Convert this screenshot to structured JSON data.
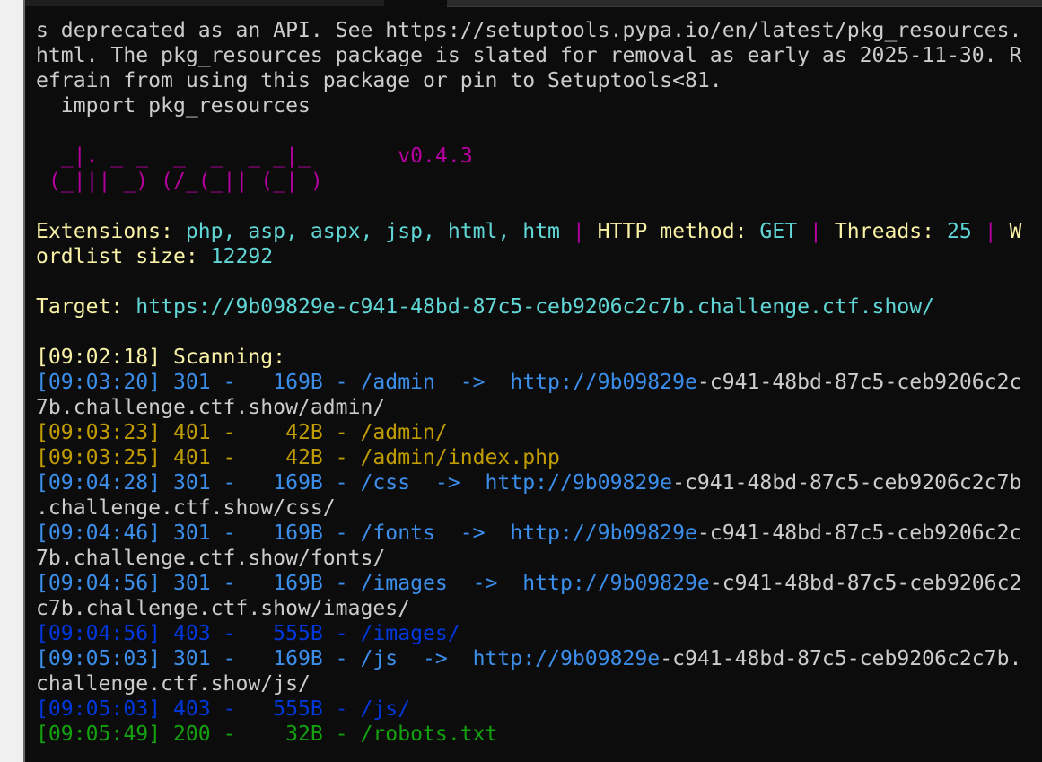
{
  "warning": {
    "line1": "s deprecated as an API. See https://setuptools.pypa.io/en/latest/pkg_resources.",
    "line2": "html. The pkg_resources package is slated for removal as early as 2025-11-30. R",
    "line3": "efrain from using this package or pin to Setuptools<81.",
    "line4": "  import pkg_resources"
  },
  "banner": {
    "line1": "  _|. _ _  _  _  _ _|_",
    "line2": " (_||| _) (/_(_|| (_| )",
    "version": "v0.4.3"
  },
  "config": {
    "extensions_label": "Extensions: ",
    "extensions_value": "php, asp, aspx, jsp, html, htm",
    "separator": " | ",
    "method_label": "HTTP method: ",
    "method_value": "GET",
    "threads_label": "Threads: ",
    "threads_value": "25",
    "wordlist_label_part1": "W",
    "wordlist_label_part2": "ordlist size: ",
    "wordlist_value": "12292"
  },
  "target": {
    "label": "Target: ",
    "url": "https://9b09829e-c941-48bd-87c5-ceb9206c2c7b.challenge.ctf.show/"
  },
  "scan": {
    "start": "[09:02:18] Scanning:",
    "results": [
      {
        "line": "[09:03:20] 301 -   169B - /admin  ->  http://9b09829e-c941-48bd-87c5-ceb9206c2c",
        "color": "#3b8eea",
        "split": 53,
        "wrap": "7b.challenge.ctf.show/admin/"
      },
      {
        "line": "[09:03:23] 401 -    42B - /admin/",
        "color": "#c19c00"
      },
      {
        "line": "[09:03:25] 401 -    42B - /admin/index.php",
        "color": "#c19c00"
      },
      {
        "line": "[09:04:28] 301 -   169B - /css  ->  http://9b09829e-c941-48bd-87c5-ceb9206c2c7b",
        "color": "#3b8eea",
        "split": 51,
        "wrap": ".challenge.ctf.show/css/"
      },
      {
        "line": "[09:04:46] 301 -   169B - /fonts  ->  http://9b09829e-c941-48bd-87c5-ceb9206c2c",
        "color": "#3b8eea",
        "split": 53,
        "wrap": "7b.challenge.ctf.show/fonts/"
      },
      {
        "line": "[09:04:56] 301 -   169B - /images  ->  http://9b09829e-c941-48bd-87c5-ceb9206c2",
        "color": "#3b8eea",
        "split": 54,
        "wrap": "c7b.challenge.ctf.show/images/"
      },
      {
        "line": "[09:04:56] 403 -   555B - /images/",
        "color": "#0037da"
      },
      {
        "line": "[09:05:03] 301 -   169B - /js  ->  http://9b09829e-c941-48bd-87c5-ceb9206c2c7b.",
        "color": "#3b8eea",
        "split": 50,
        "wrap": "challenge.ctf.show/js/"
      },
      {
        "line": "[09:05:03] 403 -   555B - /js/",
        "color": "#0037da"
      },
      {
        "line": "[09:05:49] 200 -    32B - /robots.txt",
        "color": "#13a10e"
      }
    ]
  }
}
